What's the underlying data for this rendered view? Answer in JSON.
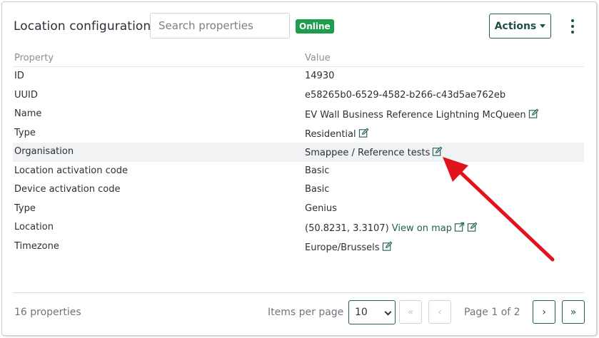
{
  "header": {
    "title": "Location configuration",
    "search_placeholder": "Search properties",
    "status_badge": "Online",
    "actions_label": "Actions"
  },
  "table": {
    "columns": {
      "property": "Property",
      "value": "Value"
    },
    "rows": [
      {
        "property": "ID",
        "value": "14930"
      },
      {
        "property": "UUID",
        "value": "e58265b0-6529-4582-b266-c43d5ae762eb"
      },
      {
        "property": "Name",
        "value": "EV Wall Business Reference Lightning McQueen"
      },
      {
        "property": "Type",
        "value": "Residential"
      },
      {
        "property": "Organisation",
        "value": "Smappee / Reference tests"
      },
      {
        "property": "Location activation code",
        "value": "Basic"
      },
      {
        "property": "Device activation code",
        "value": "Basic"
      },
      {
        "property": "Type",
        "value": "Genius"
      },
      {
        "property": "Location",
        "value": "(50.8231, 3.3107)",
        "link": "View on map"
      },
      {
        "property": "Timezone",
        "value": "Europe/Brussels"
      }
    ]
  },
  "footer": {
    "count_label": "16 properties",
    "items_per_page_label": "Items per page",
    "items_per_page_value": "10",
    "first_label": "«",
    "prev_label": "‹",
    "page_info": "Page 1 of 2",
    "next_label": "›",
    "last_label": "»"
  },
  "colors": {
    "accent": "#1e5f56",
    "badge_bg": "#1f9d4f",
    "annotation_arrow": "#e3131b",
    "highlight_row": "#f1f2f4"
  },
  "icons": [
    "edit-icon",
    "external-link-icon",
    "kebab-menu-icon",
    "caret-down-icon",
    "chevron-down-icon"
  ]
}
